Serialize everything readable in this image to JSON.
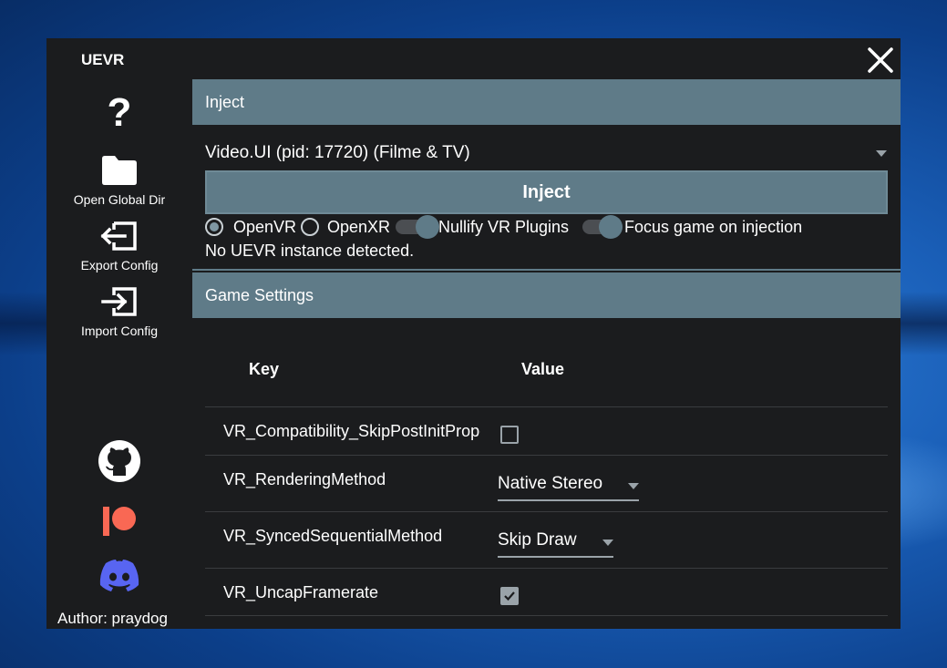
{
  "app": {
    "title": "UEVR"
  },
  "sidebar": {
    "help_label": "?",
    "open_global_dir": "Open Global Dir",
    "export_config": "Export Config",
    "import_config": "Import Config",
    "author": "Author: praydog"
  },
  "inject_section": {
    "title": "Inject",
    "selected_process": "Video.UI (pid: 17720) (Filme & TV)",
    "inject_button": "Inject",
    "runtime_options": [
      "OpenVR",
      "OpenXR"
    ],
    "selected_runtime": "OpenVR",
    "nullify_label": "Nullify VR Plugins",
    "focus_label": "Focus game on injection",
    "status": "No UEVR instance detected."
  },
  "game_settings": {
    "title": "Game Settings",
    "columns": [
      "Key",
      "Value"
    ],
    "rows": [
      {
        "key": "VR_Compatibility_SkipPostInitProperties",
        "type": "checkbox",
        "checked": false
      },
      {
        "key": "VR_RenderingMethod",
        "type": "dropdown",
        "value": "Native Stereo"
      },
      {
        "key": "VR_SyncedSequentialMethod",
        "type": "dropdown",
        "value": "Skip Draw"
      },
      {
        "key": "VR_UncapFramerate",
        "type": "checkbox",
        "checked": true
      }
    ]
  },
  "colors": {
    "accent": "#5f7b88",
    "window_bg": "#1b1c1e",
    "github": "#ffffff",
    "patreon": "#f96854",
    "discord": "#5865f2"
  }
}
